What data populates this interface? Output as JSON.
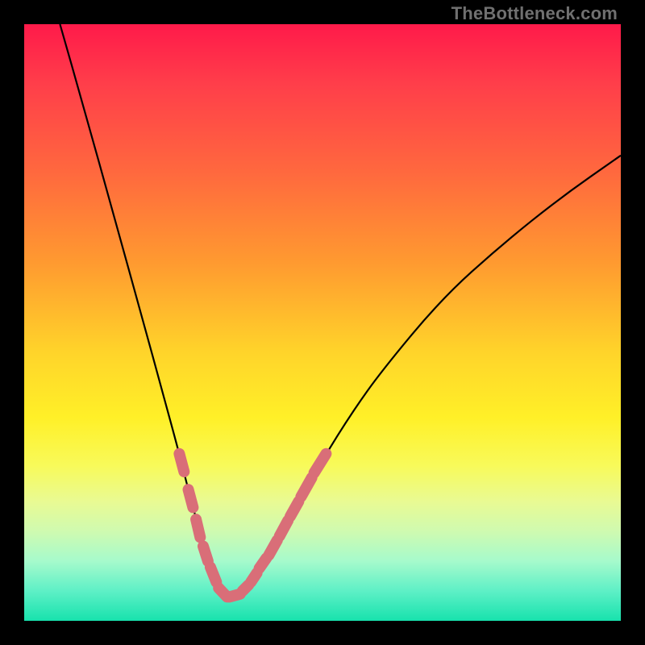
{
  "watermark": "TheBottleneck.com",
  "chart_data": {
    "type": "line",
    "title": "",
    "xlabel": "",
    "ylabel": "",
    "xlim": [
      0,
      100
    ],
    "ylim": [
      0,
      100
    ],
    "series": [
      {
        "name": "bottleneck-curve",
        "x": [
          6,
          10,
          15,
          20,
          23,
          26,
          28,
          30,
          31,
          32,
          33,
          34,
          35,
          36,
          37,
          38,
          40,
          45,
          50,
          55,
          60,
          70,
          80,
          90,
          100
        ],
        "values": [
          100,
          86,
          68,
          50,
          39,
          28,
          20,
          13,
          10,
          7,
          5,
          4,
          4,
          4,
          5,
          6,
          9,
          18,
          27,
          35,
          42,
          54,
          63,
          71,
          78
        ]
      }
    ],
    "overlay_segments": {
      "name": "highlighted-bead-segments",
      "color": "#d96e78",
      "segments": [
        {
          "x": [
            26.0,
            26.8
          ],
          "values": [
            28.0,
            25.0
          ]
        },
        {
          "x": [
            27.5,
            28.3
          ],
          "values": [
            22.0,
            19.0
          ]
        },
        {
          "x": [
            28.8,
            29.5
          ],
          "values": [
            17.0,
            14.0
          ]
        },
        {
          "x": [
            30.0,
            30.8
          ],
          "values": [
            12.5,
            10.0
          ]
        },
        {
          "x": [
            31.2,
            32.2
          ],
          "values": [
            9.0,
            6.5
          ]
        },
        {
          "x": [
            32.6,
            34.0
          ],
          "values": [
            5.5,
            4.0
          ]
        },
        {
          "x": [
            34.4,
            36.2
          ],
          "values": [
            4.0,
            4.5
          ]
        },
        {
          "x": [
            36.6,
            37.6
          ],
          "values": [
            5.0,
            6.0
          ]
        },
        {
          "x": [
            38.0,
            39.0
          ],
          "values": [
            6.5,
            8.0
          ]
        },
        {
          "x": [
            39.4,
            40.6
          ],
          "values": [
            8.8,
            10.5
          ]
        },
        {
          "x": [
            41.0,
            42.4
          ],
          "values": [
            11.0,
            13.5
          ]
        },
        {
          "x": [
            42.8,
            44.2
          ],
          "values": [
            14.2,
            16.8
          ]
        },
        {
          "x": [
            44.6,
            46.0
          ],
          "values": [
            17.5,
            20.0
          ]
        },
        {
          "x": [
            46.4,
            48.2
          ],
          "values": [
            20.8,
            24.0
          ]
        },
        {
          "x": [
            48.6,
            50.6
          ],
          "values": [
            24.8,
            28.0
          ]
        }
      ]
    },
    "gradient_stops": [
      {
        "pos": 0,
        "color": "#ff1a4a"
      },
      {
        "pos": 25,
        "color": "#ff693e"
      },
      {
        "pos": 55,
        "color": "#ffd42a"
      },
      {
        "pos": 74,
        "color": "#f8fa5a"
      },
      {
        "pos": 90,
        "color": "#a6facc"
      },
      {
        "pos": 100,
        "color": "#17e2ad"
      }
    ]
  }
}
